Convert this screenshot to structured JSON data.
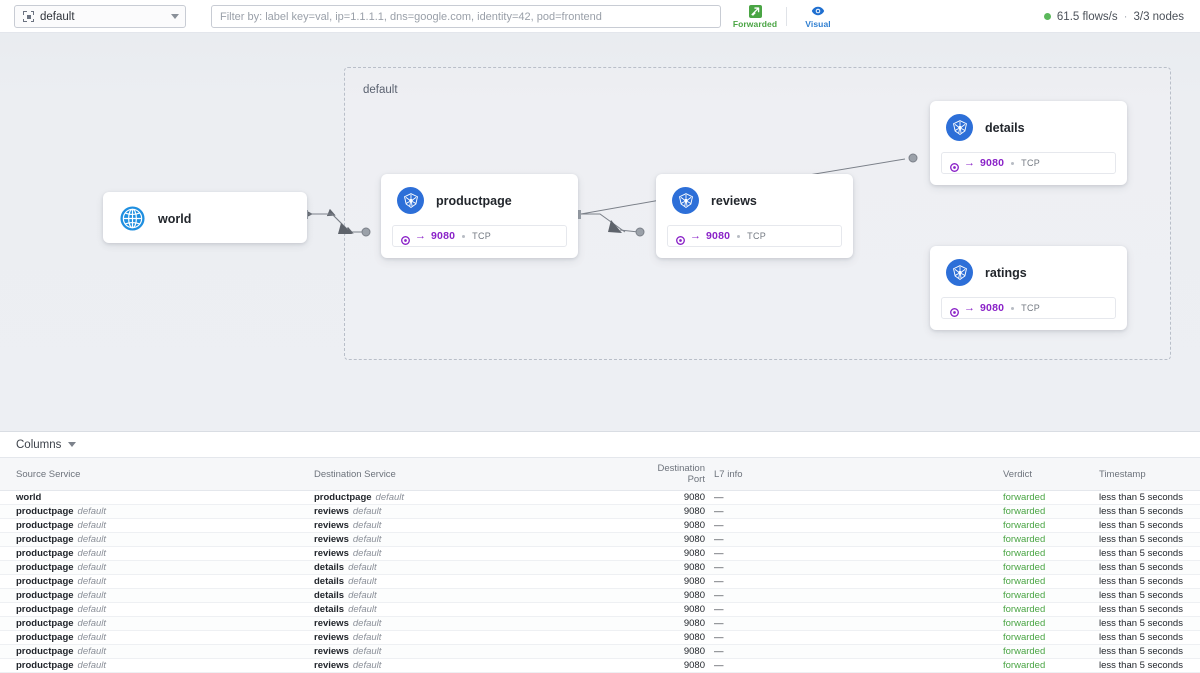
{
  "topbar": {
    "namespace_select": {
      "value": "default",
      "icon": "namespace-icon"
    },
    "filter": {
      "placeholder": "Filter by: label key=val, ip=1.1.1.1, dns=google.com, identity=42, pod=frontend",
      "value": ""
    },
    "buttons": [
      {
        "label": "Forwarded",
        "icon": "forwarded-icon",
        "color": "#4aa544"
      },
      {
        "label": "Visual",
        "icon": "eye-icon",
        "color": "#2f7fd1"
      }
    ],
    "status": {
      "flows": "61.5 flows/s",
      "separator": "·",
      "nodes": "3/3 nodes",
      "indicator_color": "#5bb85b"
    }
  },
  "graph": {
    "namespace_label": "default",
    "nodes": [
      {
        "id": "world",
        "title": "world",
        "icon": "globe-icon",
        "has_port": false
      },
      {
        "id": "productpage",
        "title": "productpage",
        "icon": "kubernetes-icon",
        "has_port": true,
        "port": {
          "arrow": "→",
          "number": "9080",
          "protocol": "TCP"
        }
      },
      {
        "id": "reviews",
        "title": "reviews",
        "icon": "kubernetes-icon",
        "has_port": true,
        "port": {
          "arrow": "→",
          "number": "9080",
          "protocol": "TCP"
        }
      },
      {
        "id": "details",
        "title": "details",
        "icon": "kubernetes-icon",
        "has_port": true,
        "port": {
          "arrow": "→",
          "number": "9080",
          "protocol": "TCP"
        }
      },
      {
        "id": "ratings",
        "title": "ratings",
        "icon": "kubernetes-icon",
        "has_port": true,
        "port": {
          "arrow": "→",
          "number": "9080",
          "protocol": "TCP"
        }
      }
    ],
    "edges": [
      {
        "from": "world",
        "to": "productpage"
      },
      {
        "from": "productpage",
        "to": "reviews"
      },
      {
        "from": "productpage",
        "to": "details"
      }
    ]
  },
  "table": {
    "columns_toggle": "Columns",
    "headers": [
      "Source Service",
      "Destination Service",
      "Destination Port",
      "L7 info",
      "Verdict",
      "Timestamp"
    ],
    "rows": [
      {
        "src_name": "world",
        "src_ns": "",
        "dst_name": "productpage",
        "dst_ns": "default",
        "port": "9080",
        "l7": "—",
        "verdict": "forwarded",
        "timestamp": "less than 5 seconds"
      },
      {
        "src_name": "productpage",
        "src_ns": "default",
        "dst_name": "reviews",
        "dst_ns": "default",
        "port": "9080",
        "l7": "—",
        "verdict": "forwarded",
        "timestamp": "less than 5 seconds"
      },
      {
        "src_name": "productpage",
        "src_ns": "default",
        "dst_name": "reviews",
        "dst_ns": "default",
        "port": "9080",
        "l7": "—",
        "verdict": "forwarded",
        "timestamp": "less than 5 seconds"
      },
      {
        "src_name": "productpage",
        "src_ns": "default",
        "dst_name": "reviews",
        "dst_ns": "default",
        "port": "9080",
        "l7": "—",
        "verdict": "forwarded",
        "timestamp": "less than 5 seconds"
      },
      {
        "src_name": "productpage",
        "src_ns": "default",
        "dst_name": "reviews",
        "dst_ns": "default",
        "port": "9080",
        "l7": "—",
        "verdict": "forwarded",
        "timestamp": "less than 5 seconds"
      },
      {
        "src_name": "productpage",
        "src_ns": "default",
        "dst_name": "details",
        "dst_ns": "default",
        "port": "9080",
        "l7": "—",
        "verdict": "forwarded",
        "timestamp": "less than 5 seconds"
      },
      {
        "src_name": "productpage",
        "src_ns": "default",
        "dst_name": "details",
        "dst_ns": "default",
        "port": "9080",
        "l7": "—",
        "verdict": "forwarded",
        "timestamp": "less than 5 seconds"
      },
      {
        "src_name": "productpage",
        "src_ns": "default",
        "dst_name": "details",
        "dst_ns": "default",
        "port": "9080",
        "l7": "—",
        "verdict": "forwarded",
        "timestamp": "less than 5 seconds"
      },
      {
        "src_name": "productpage",
        "src_ns": "default",
        "dst_name": "details",
        "dst_ns": "default",
        "port": "9080",
        "l7": "—",
        "verdict": "forwarded",
        "timestamp": "less than 5 seconds"
      },
      {
        "src_name": "productpage",
        "src_ns": "default",
        "dst_name": "reviews",
        "dst_ns": "default",
        "port": "9080",
        "l7": "—",
        "verdict": "forwarded",
        "timestamp": "less than 5 seconds"
      },
      {
        "src_name": "productpage",
        "src_ns": "default",
        "dst_name": "reviews",
        "dst_ns": "default",
        "port": "9080",
        "l7": "—",
        "verdict": "forwarded",
        "timestamp": "less than 5 seconds"
      },
      {
        "src_name": "productpage",
        "src_ns": "default",
        "dst_name": "reviews",
        "dst_ns": "default",
        "port": "9080",
        "l7": "—",
        "verdict": "forwarded",
        "timestamp": "less than 5 seconds"
      },
      {
        "src_name": "productpage",
        "src_ns": "default",
        "dst_name": "reviews",
        "dst_ns": "default",
        "port": "9080",
        "l7": "—",
        "verdict": "forwarded",
        "timestamp": "less than 5 seconds"
      }
    ]
  }
}
